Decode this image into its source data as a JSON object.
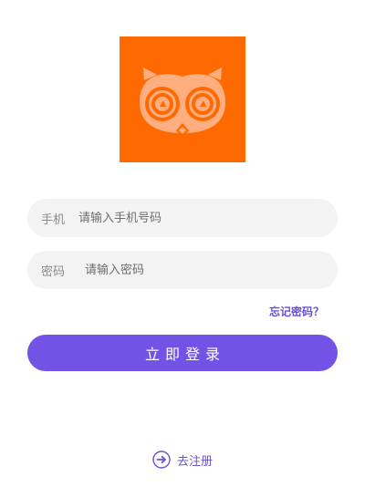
{
  "logo": {
    "name": "owl-logo",
    "background_color": "#ff6a00",
    "icon": "owl-icon"
  },
  "form": {
    "phone": {
      "label": "手机",
      "placeholder": "请输入手机号码",
      "value": ""
    },
    "password": {
      "label": "密码",
      "placeholder": "请输入密码",
      "value": ""
    },
    "forgot_password": "忘记密码？",
    "login_button": "立即登录"
  },
  "register": {
    "icon": "arrow-right-circle-icon",
    "label": "去注册"
  },
  "colors": {
    "accent": "#7352e6",
    "link": "#6a4fd8",
    "input_background": "#f3f3f3",
    "logo_orange": "#ff6a00"
  }
}
